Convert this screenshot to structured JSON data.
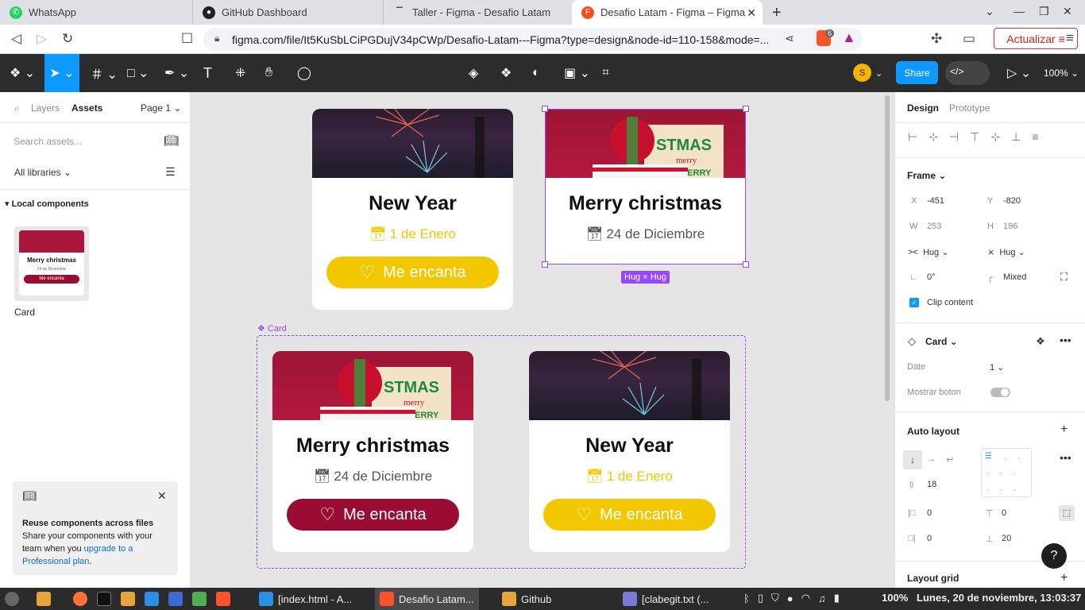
{
  "browser": {
    "tabs": [
      {
        "label": "WhatsApp",
        "color": "#25d366"
      },
      {
        "label": "GitHub Dashboard",
        "color": "#222222"
      },
      {
        "label": "Taller - Figma - Desafio Latam",
        "color": "#555555"
      },
      {
        "label": "Desafio Latam - Figma – Figma",
        "color": "#f24e1e"
      }
    ],
    "url": "figma.com/file/It5KuSbLCiPGDujV34pCWp/Desafio-Latam---Figma?type=design&node-id=110-158&mode=...",
    "update_label": "Actualizar",
    "extension_badge": "6"
  },
  "figma_toolbar": {
    "avatar_letter": "S",
    "share_label": "Share",
    "zoom": "100%"
  },
  "left_panel": {
    "tab_layers": "Layers",
    "tab_assets": "Assets",
    "page": "Page 1",
    "search_placeholder": "Search assets...",
    "libraries": "All libraries",
    "local_components": "Local components",
    "component_name": "Card",
    "thumb_title": "Merry christmas",
    "thumb_date": "24 de Diciembre",
    "thumb_btn": "Me encanta",
    "promo_title": "Reuse components across files",
    "promo_text": "Share your components with your team when you",
    "promo_link": "upgrade to a Professional plan",
    "promo_end": "."
  },
  "canvas": {
    "component_label": "Card",
    "hug_badge": "Hug × Hug",
    "cards": [
      {
        "title": "New Year",
        "date": "1 de Enero",
        "button": "Me encanta",
        "theme": "fire",
        "date_color": "#f2c700"
      },
      {
        "title": "Merry christmas",
        "date": "24 de Diciembre",
        "button": "",
        "theme": "xmas",
        "date_color": "#555555"
      },
      {
        "title": "Merry christmas",
        "date": "24 de Diciembre",
        "button": "Me encanta",
        "theme": "xmas",
        "date_color": "#555555"
      },
      {
        "title": "New Year",
        "date": "1 de Enero",
        "button": "Me encanta",
        "theme": "fire",
        "date_color": "#f2c700"
      }
    ]
  },
  "right_panel": {
    "tab_design": "Design",
    "tab_prototype": "Prototype",
    "frame_label": "Frame",
    "x_label": "X",
    "x_value": "-451",
    "y_label": "Y",
    "y_value": "-820",
    "w_label": "W",
    "w_value": "253",
    "h_label": "H",
    "h_value": "196",
    "hug_w": "Hug",
    "hug_h": "Hug",
    "rotation": "0°",
    "radius": "Mixed",
    "clip_content": "Clip content",
    "component": "Card",
    "prop_date": "Date",
    "prop_date_value": "1",
    "prop_button": "Mostrar boton",
    "auto_layout": "Auto layout",
    "gap": "18",
    "pad_left": "0",
    "pad_top": "0",
    "pad_right": "0",
    "pad_bottom": "20",
    "layout_grid": "Layout grid"
  },
  "taskbar": {
    "items": [
      "[index.html - A...",
      "Desafio Latam...",
      "Github",
      "[clabegit.txt (..."
    ],
    "battery": "100%",
    "datetime": "Lunes, 20 de noviembre, 13:03:37"
  },
  "colors": {
    "accent": "#0d99ff",
    "yellow": "#f2c700",
    "red": "#9b0c34",
    "selection": "#9747ff"
  }
}
